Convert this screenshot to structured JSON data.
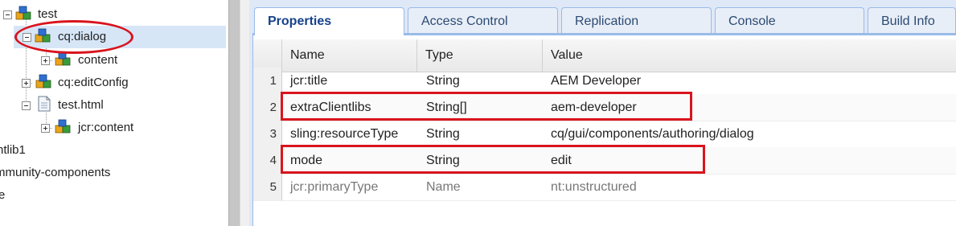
{
  "tree": {
    "nodes": [
      {
        "label": "test"
      },
      {
        "label": "cq:dialog"
      },
      {
        "label": "content"
      },
      {
        "label": "cq:editConfig"
      },
      {
        "label": "test.html"
      },
      {
        "label": "jcr:content"
      },
      {
        "label": "ntlib1"
      },
      {
        "label": "mmunity-components"
      },
      {
        "label": "e"
      }
    ]
  },
  "tabs": [
    {
      "label": "Properties"
    },
    {
      "label": "Access Control"
    },
    {
      "label": "Replication"
    },
    {
      "label": "Console"
    },
    {
      "label": "Build Info"
    }
  ],
  "grid": {
    "headers": {
      "name": "Name",
      "type": "Type",
      "value": "Value"
    },
    "rows": [
      {
        "num": "1",
        "name": "jcr:title",
        "type": "String",
        "value": "AEM Developer"
      },
      {
        "num": "2",
        "name": "extraClientlibs",
        "type": "String[]",
        "value": "aem-developer"
      },
      {
        "num": "3",
        "name": "sling:resourceType",
        "type": "String",
        "value": "cq/gui/components/authoring/dialog"
      },
      {
        "num": "4",
        "name": "mode",
        "type": "String",
        "value": "edit"
      },
      {
        "num": "5",
        "name": "jcr:primaryType",
        "type": "Name",
        "value": "nt:unstructured"
      }
    ]
  },
  "colors": {
    "highlight": "#d9141d",
    "selection": "#d6e6f7",
    "tab_border": "#99bbe8"
  }
}
